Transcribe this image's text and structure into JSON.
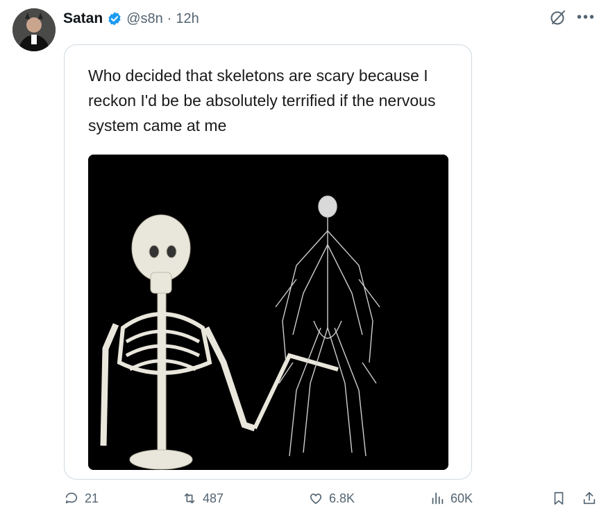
{
  "post": {
    "author_name": "Satan",
    "handle": "@s8n",
    "separator": "·",
    "time": "12h"
  },
  "meme": {
    "caption": "Who decided that skeletons are scary because I reckon I'd be be absolutely terrified if the nervous system came at me"
  },
  "actions": {
    "replies": "21",
    "reposts": "487",
    "likes": "6.8K",
    "views": "60K"
  },
  "colors": {
    "verified_blue": "#1d9bf0",
    "muted_gray": "#536471",
    "border": "#cfd9de"
  },
  "icons": [
    "verified-badge-icon",
    "grok-icon",
    "more-icon",
    "reply-icon",
    "repost-icon",
    "like-icon",
    "views-icon",
    "bookmark-icon",
    "share-icon"
  ]
}
